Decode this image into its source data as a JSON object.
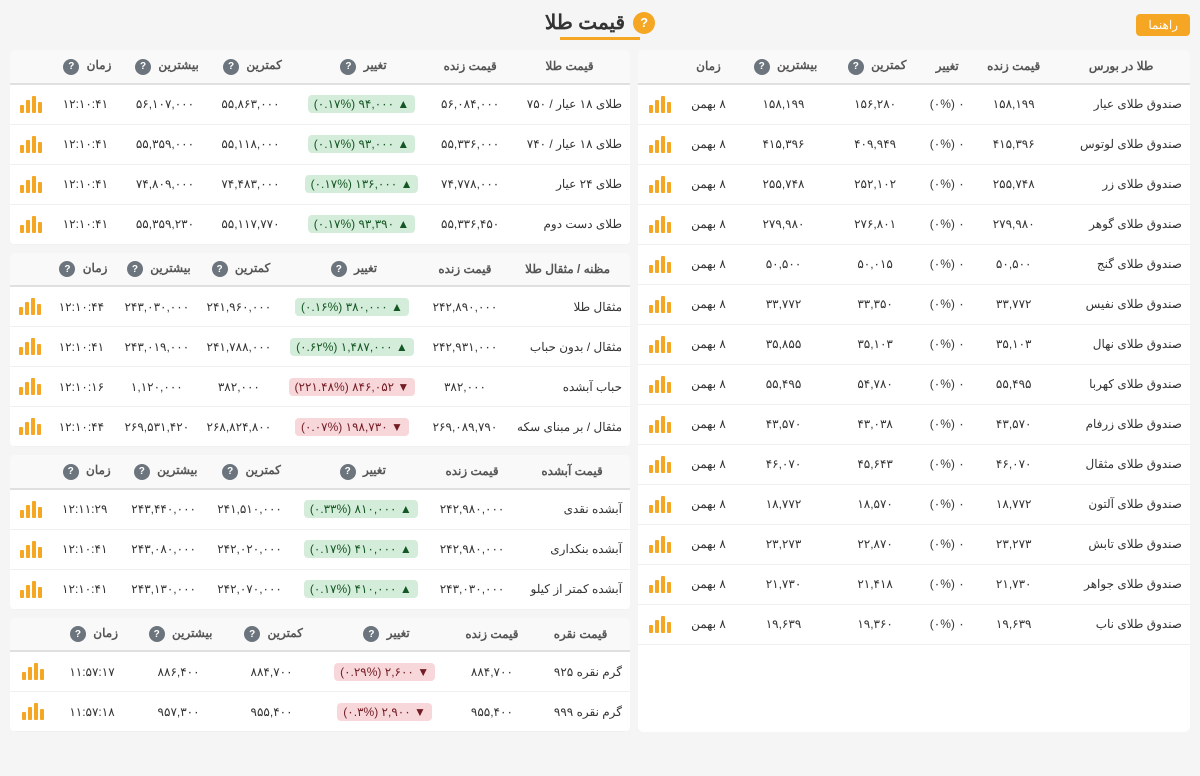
{
  "page": {
    "title": "قیمت طلا",
    "راهنما": "راهنما",
    "question_mark": "?"
  },
  "gold_funds": {
    "headers": [
      "طلا در بورس",
      "قیمت زنده",
      "تغییر",
      "کمترین",
      "بیشترین",
      "زمان"
    ],
    "rows": [
      {
        "name": "صندوق طلای عیار",
        "price": "۱۵۸,۱۹۹",
        "change": "۰ (۰%)",
        "min": "۱۵۶,۲۸۰",
        "max": "۱۵۸,۱۹۹",
        "time": "۸ بهمن"
      },
      {
        "name": "صندوق طلای لوتوس",
        "price": "۴۱۵,۳۹۶",
        "change": "۰ (۰%)",
        "min": "۴۰۹,۹۴۹",
        "max": "۴۱۵,۳۹۶",
        "time": "۸ بهمن"
      },
      {
        "name": "صندوق طلای زر",
        "price": "۲۵۵,۷۴۸",
        "change": "۰ (۰%)",
        "min": "۲۵۲,۱۰۲",
        "max": "۲۵۵,۷۴۸",
        "time": "۸ بهمن"
      },
      {
        "name": "صندوق طلای گوهر",
        "price": "۲۷۹,۹۸۰",
        "change": "۰ (۰%)",
        "min": "۲۷۶,۸۰۱",
        "max": "۲۷۹,۹۸۰",
        "time": "۸ بهمن"
      },
      {
        "name": "صندوق طلای گنج",
        "price": "۵۰,۵۰۰",
        "change": "۰ (۰%)",
        "min": "۵۰,۰۱۵",
        "max": "۵۰,۵۰۰",
        "time": "۸ بهمن"
      },
      {
        "name": "صندوق طلای نفیس",
        "price": "۳۳,۷۷۲",
        "change": "۰ (۰%)",
        "min": "۳۳,۳۵۰",
        "max": "۳۳,۷۷۲",
        "time": "۸ بهمن"
      },
      {
        "name": "صندوق طلای نهال",
        "price": "۳۵,۱۰۳",
        "change": "۰ (۰%)",
        "min": "۳۵,۱۰۳",
        "max": "۳۵,۸۵۵",
        "time": "۸ بهمن"
      },
      {
        "name": "صندوق طلای کهربا",
        "price": "۵۵,۴۹۵",
        "change": "۰ (۰%)",
        "min": "۵۴,۷۸۰",
        "max": "۵۵,۴۹۵",
        "time": "۸ بهمن"
      },
      {
        "name": "صندوق طلای زرفام",
        "price": "۴۳,۵۷۰",
        "change": "۰ (۰%)",
        "min": "۴۳,۰۳۸",
        "max": "۴۳,۵۷۰",
        "time": "۸ بهمن"
      },
      {
        "name": "صندوق طلای مثقال",
        "price": "۴۶,۰۷۰",
        "change": "۰ (۰%)",
        "min": "۴۵,۶۴۳",
        "max": "۴۶,۰۷۰",
        "time": "۸ بهمن"
      },
      {
        "name": "صندوق طلای آلتون",
        "price": "۱۸,۷۷۲",
        "change": "۰ (۰%)",
        "min": "۱۸,۵۷۰",
        "max": "۱۸,۷۷۲",
        "time": "۸ بهمن"
      },
      {
        "name": "صندوق طلای تابش",
        "price": "۲۳,۲۷۳",
        "change": "۰ (۰%)",
        "min": "۲۲,۸۷۰",
        "max": "۲۳,۲۷۳",
        "time": "۸ بهمن"
      },
      {
        "name": "صندوق طلای جواهر",
        "price": "۲۱,۷۳۰",
        "change": "۰ (۰%)",
        "min": "۲۱,۴۱۸",
        "max": "۲۱,۷۳۰",
        "time": "۸ بهمن"
      },
      {
        "name": "صندوق طلای ناب",
        "price": "۱۹,۶۳۹",
        "change": "۰ (۰%)",
        "min": "۱۹,۳۶۰",
        "max": "۱۹,۶۳۹",
        "time": "۸ بهمن"
      }
    ]
  },
  "gold_price": {
    "section_title": "قیمت طلا",
    "headers": [
      "قیمت طلا",
      "قیمت زنده",
      "تغییر",
      "کمترین",
      "بیشترین",
      "زمان"
    ],
    "rows": [
      {
        "name": "طلای ۱۸ عیار / ۷۵۰",
        "price": "۵۶,۰۸۴,۰۰۰",
        "change": "۹۴,۰۰۰ (۰.۱۷%)",
        "change_dir": "up",
        "min": "۵۵,۸۶۳,۰۰۰",
        "max": "۵۶,۱۰۷,۰۰۰",
        "time": "۱۲:۱۰:۴۱"
      },
      {
        "name": "طلای ۱۸ عیار / ۷۴۰",
        "price": "۵۵,۳۳۶,۰۰۰",
        "change": "۹۳,۰۰۰ (۰.۱۷%)",
        "change_dir": "up",
        "min": "۵۵,۱۱۸,۰۰۰",
        "max": "۵۵,۳۵۹,۰۰۰",
        "time": "۱۲:۱۰:۴۱"
      },
      {
        "name": "طلای ۲۴ عیار",
        "price": "۷۴,۷۷۸,۰۰۰",
        "change": "۱۳۶,۰۰۰ (۰.۱۷%)",
        "change_dir": "up",
        "min": "۷۴,۴۸۳,۰۰۰",
        "max": "۷۴,۸۰۹,۰۰۰",
        "time": "۱۲:۱۰:۴۱"
      },
      {
        "name": "طلای دست دوم",
        "price": "۵۵,۳۳۶,۴۵۰",
        "change": "۹۳,۳۹۰ (۰.۱۷%)",
        "change_dir": "up",
        "min": "۵۵,۱۱۷,۷۷۰",
        "max": "۵۵,۳۵۹,۲۳۰",
        "time": "۱۲:۱۰:۴۱"
      }
    ]
  },
  "mithqal": {
    "section_title": "مظنه / مثقال طلا",
    "headers": [
      "مظنه / مثقال طلا",
      "قیمت زنده",
      "تغییر",
      "کمترین",
      "بیشترین",
      "زمان"
    ],
    "rows": [
      {
        "name": "مثقال طلا",
        "price": "۲۴۲,۸۹۰,۰۰۰",
        "change": "۳۸۰,۰۰۰ (۰.۱۶%)",
        "change_dir": "up",
        "min": "۲۴۱,۹۶۰,۰۰۰",
        "max": "۲۴۳,۰۳۰,۰۰۰",
        "time": "۱۲:۱۰:۴۴"
      },
      {
        "name": "مثقال / بدون حباب",
        "price": "۲۴۲,۹۳۱,۰۰۰",
        "change": "۱,۴۸۷,۰۰۰ (۰.۶۲%)",
        "change_dir": "up",
        "min": "۲۴۱,۷۸۸,۰۰۰",
        "max": "۲۴۳,۰۱۹,۰۰۰",
        "time": "۱۲:۱۰:۴۱"
      },
      {
        "name": "حباب آبشده",
        "price": "۳۸۲,۰۰۰",
        "change": "۸۴۶,۰۵۲ (۲۲۱.۴۸%)",
        "change_dir": "down",
        "min": "۳۸۲,۰۰۰",
        "max": "۱,۱۲۰,۰۰۰",
        "time": "۱۲:۱۰:۱۶"
      },
      {
        "name": "مثقال / بر مبنای سکه",
        "price": "۲۶۹,۰۸۹,۷۹۰",
        "change": "۱۹۸,۷۳۰ (۰.۰۷%)",
        "change_dir": "down",
        "min": "۲۶۸,۸۲۴,۸۰۰",
        "max": "۲۶۹,۵۳۱,۴۲۰",
        "time": "۱۲:۱۰:۴۴"
      }
    ]
  },
  "abshode": {
    "section_title": "قیمت آبشده",
    "headers": [
      "قیمت آبشده",
      "قیمت زنده",
      "تغییر",
      "کمترین",
      "بیشترین",
      "زمان"
    ],
    "rows": [
      {
        "name": "آبشده نقدی",
        "price": "۲۴۲,۹۸۰,۰۰۰",
        "change": "۸۱۰,۰۰۰ (۰.۳۳%)",
        "change_dir": "up",
        "min": "۲۴۱,۵۱۰,۰۰۰",
        "max": "۲۴۳,۴۴۰,۰۰۰",
        "time": "۱۲:۱۱:۲۹"
      },
      {
        "name": "آبشده بنکداری",
        "price": "۲۴۲,۹۸۰,۰۰۰",
        "change": "۴۱۰,۰۰۰ (۰.۱۷%)",
        "change_dir": "up",
        "min": "۲۴۲,۰۲۰,۰۰۰",
        "max": "۲۴۳,۰۸۰,۰۰۰",
        "time": "۱۲:۱۰:۴۱"
      },
      {
        "name": "آبشده کمتر از کیلو",
        "price": "۲۴۳,۰۳۰,۰۰۰",
        "change": "۴۱۰,۰۰۰ (۰.۱۷%)",
        "change_dir": "up",
        "min": "۲۴۲,۰۷۰,۰۰۰",
        "max": "۲۴۳,۱۳۰,۰۰۰",
        "time": "۱۲:۱۰:۴۱"
      }
    ]
  },
  "silver": {
    "section_title": "قیمت نقره",
    "headers": [
      "قیمت نقره",
      "قیمت زنده",
      "تغییر",
      "کمترین",
      "بیشترین",
      "زمان"
    ],
    "rows": [
      {
        "name": "گرم نقره ۹۲۵",
        "price": "۸۸۴,۷۰۰",
        "change": "۲,۶۰۰ (۰.۲۹%)",
        "change_dir": "down",
        "min": "۸۸۴,۷۰۰",
        "max": "۸۸۶,۴۰۰",
        "time": "۱۱:۵۷:۱۷"
      },
      {
        "name": "گرم نقره ۹۹۹",
        "price": "۹۵۵,۴۰۰",
        "change": "۲,۹۰۰ (۰.۳%)",
        "change_dir": "down",
        "min": "۹۵۵,۴۰۰",
        "max": "۹۵۷,۳۰۰",
        "time": "۱۱:۵۷:۱۸"
      }
    ]
  }
}
